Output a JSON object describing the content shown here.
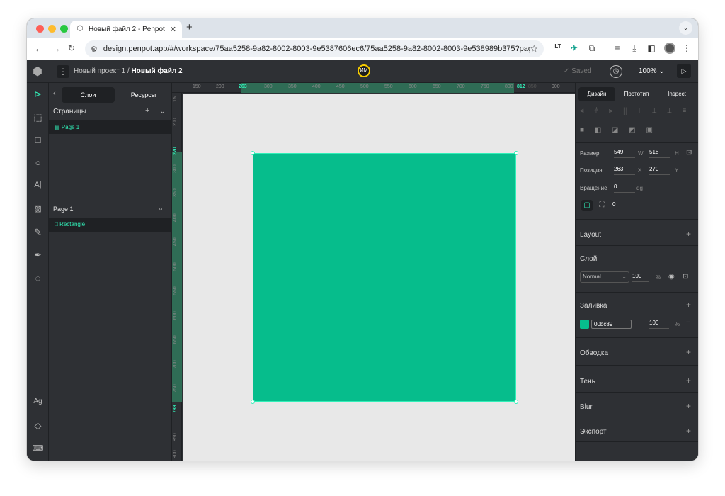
{
  "browser": {
    "tab_title": "Новый файл 2 - Penpot",
    "tab_close": "✕",
    "new_tab": "+",
    "tab_menu": "⌄",
    "url": "design.penpot.app/#/workspace/75aa5258-9a82-8002-8003-9e5387606ec6/75aa5258-9a82-8002-8003-9e538989b375?page-i...",
    "traffic_colors": [
      "#fe5f57",
      "#febc2e",
      "#28c840"
    ]
  },
  "header": {
    "project": "Новый проект 1 /",
    "file": "Новый файл 2",
    "user_initials": "ИМ",
    "saved": "✓  Saved",
    "zoom": "100% ⌄"
  },
  "left_panel": {
    "tab_layers": "Слои",
    "tab_assets": "Ресурсы",
    "pages_title": "Страницы",
    "pages": [
      "Page 1"
    ],
    "current_page": "Page 1",
    "layers": [
      "Rectangle"
    ]
  },
  "tools": [
    "move",
    "board",
    "rectangle",
    "ellipse",
    "text",
    "image",
    "curve",
    "path",
    "comments"
  ],
  "bottom_tools": [
    "Ag"
  ],
  "ruler": {
    "top_ticks": [
      "150",
      "200",
      "263",
      "300",
      "350",
      "400",
      "450",
      "500",
      "550",
      "600",
      "650",
      "700",
      "750",
      "800",
      "812",
      "850",
      "900"
    ],
    "left_ticks": [
      "15",
      "200",
      "270",
      "300",
      "350",
      "400",
      "450",
      "500",
      "550",
      "600",
      "650",
      "700",
      "750",
      "788",
      "850",
      "900"
    ]
  },
  "design_panel": {
    "tabs": [
      "Дизайн",
      "Прототип",
      "Inspect"
    ],
    "size_label": "Размер",
    "width": "549",
    "w_unit": "W",
    "height": "518",
    "h_unit": "H",
    "position_label": "Позиция",
    "x": "263",
    "x_unit": "X",
    "y": "270",
    "y_unit": "Y",
    "rotation_label": "Вращение",
    "rotation": "0",
    "rotation_unit": "dg",
    "radius": "0",
    "layout": "Layout",
    "layer": "Слой",
    "blend": "Normal",
    "opacity": "100",
    "percent": "%",
    "fill": "Заливка",
    "fill_hex": "00bc89",
    "fill_opacity": "100",
    "stroke": "Обводка",
    "shadow": "Тень",
    "blur": "Blur",
    "export": "Экспорт",
    "fill_color": "#06bd8c"
  }
}
